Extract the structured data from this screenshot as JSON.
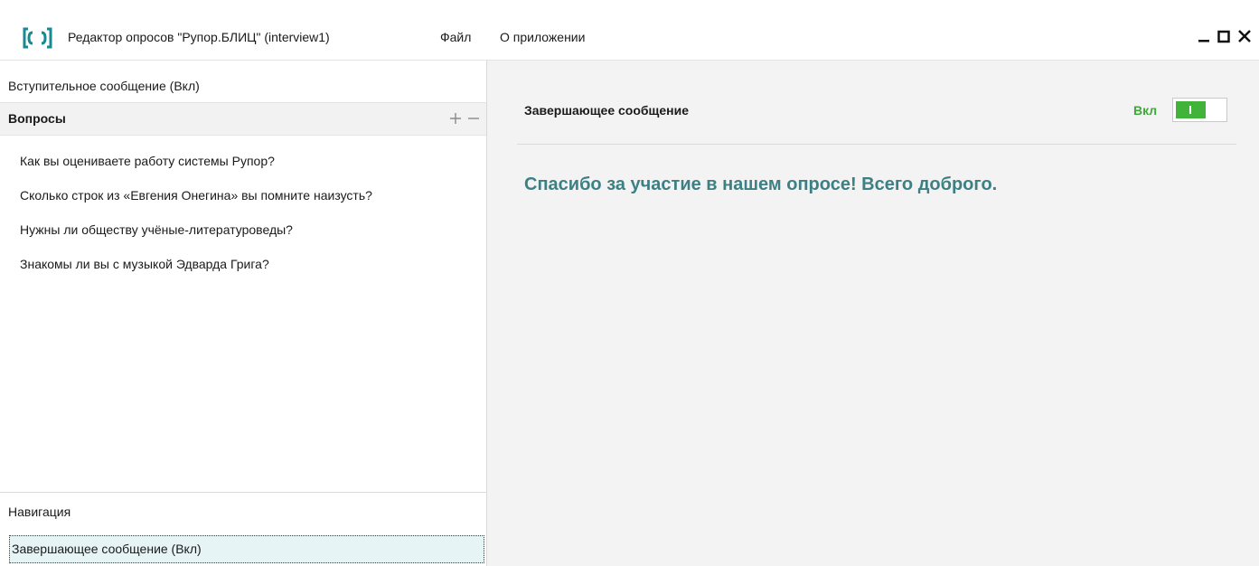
{
  "window": {
    "title": "Редактор опросов \"Рупор.БЛИЦ\" (interview1)",
    "menu": {
      "file": "Файл",
      "about": "О приложении"
    },
    "controls": {
      "minimize": "minimize-icon",
      "maximize": "maximize-icon",
      "close": "close-icon"
    },
    "logo_color": "#1a8a92"
  },
  "left_panel": {
    "intro_item": "Вступительное сообщение (Вкл)",
    "questions_header": "Вопросы",
    "questions": [
      "Как вы оцениваете работу системы Рупор?",
      "Сколько строк из «Евгения Онегина» вы помните наизусть?",
      "Нужны ли обществу учёные-литературоведы?",
      "Знакомы ли вы с музыкой Эдварда Грига?"
    ],
    "navigation_item": "Навигация",
    "ending_item": "Завершающее сообщение (Вкл)",
    "selected_highlight_color": "#e6f4f5"
  },
  "right_panel": {
    "title": "Завершающее сообщение",
    "toggle_label": "Вкл",
    "toggle_on": true,
    "toggle_color": "#41b23a",
    "message": "Спасибо за участие в нашем опросе! Всего доброго.",
    "message_color": "#3d8084"
  }
}
